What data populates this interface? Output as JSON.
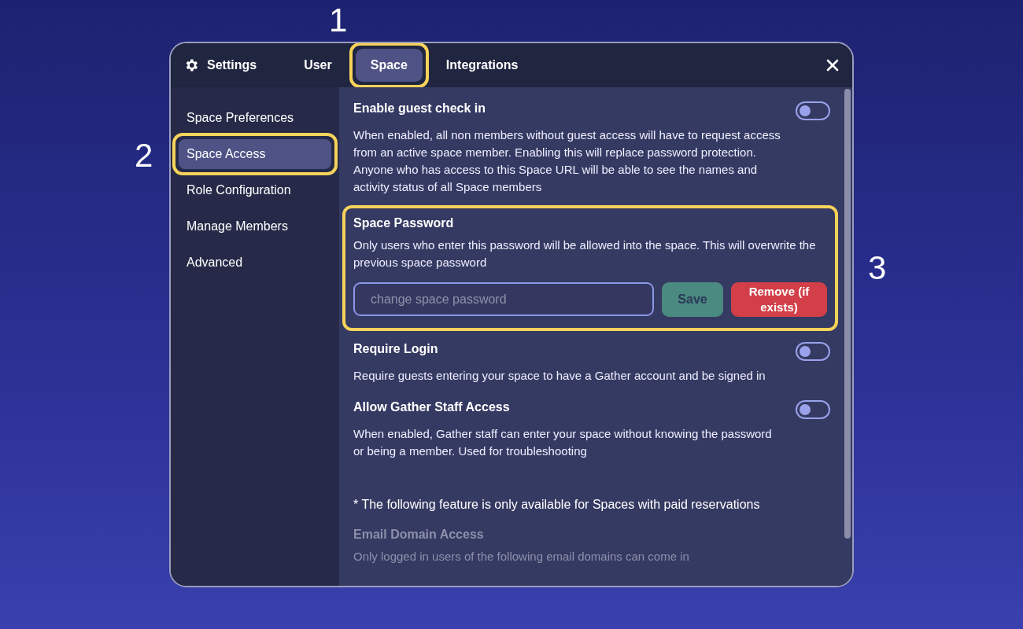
{
  "window": {
    "title": "Settings"
  },
  "tabs": [
    {
      "label": "User",
      "selected": false,
      "highlighted": false
    },
    {
      "label": "Space",
      "selected": true,
      "highlighted": true
    },
    {
      "label": "Integrations",
      "selected": false,
      "highlighted": false
    }
  ],
  "callouts": [
    {
      "label": "1"
    },
    {
      "label": "2"
    },
    {
      "label": "3"
    }
  ],
  "sidebar": {
    "items": [
      {
        "label": "Space Preferences",
        "selected": false,
        "highlighted": false
      },
      {
        "label": "Space Access",
        "selected": true,
        "highlighted": true
      },
      {
        "label": "Role Configuration",
        "selected": false,
        "highlighted": false
      },
      {
        "label": "Manage Members",
        "selected": false,
        "highlighted": false
      },
      {
        "label": "Advanced",
        "selected": false,
        "highlighted": false
      }
    ]
  },
  "sections": [
    {
      "kind": "toggle",
      "title": "Enable guest check in",
      "description": "When enabled, all non members without guest access will have to request access from an active space member. Enabling this will replace password protection. Anyone who has access to this Space URL will be able to see the names and activity status of all Space members",
      "on": false
    },
    {
      "kind": "password",
      "title": "Space Password",
      "description": "Only users who enter this password will be allowed into the space. This will overwrite the previous space password",
      "placeholder": "change space password",
      "save": "Save",
      "remove": "Remove (if exists)",
      "highlighted": true
    },
    {
      "kind": "toggle",
      "title": "Require Login",
      "description": "Require guests entering your space to have a Gather account and be signed in",
      "on": false
    },
    {
      "kind": "toggle",
      "title": "Allow Gather Staff Access",
      "description": "When enabled, Gather staff can enter your space without knowing the password or being a member. Used for troubleshooting",
      "on": false
    },
    {
      "kind": "note",
      "text": "* The following feature is only available for Spaces with paid reservations"
    },
    {
      "kind": "info",
      "title": "Email Domain Access",
      "description": "Only logged in users of the following email domains can come in",
      "disabled": true
    }
  ]
}
